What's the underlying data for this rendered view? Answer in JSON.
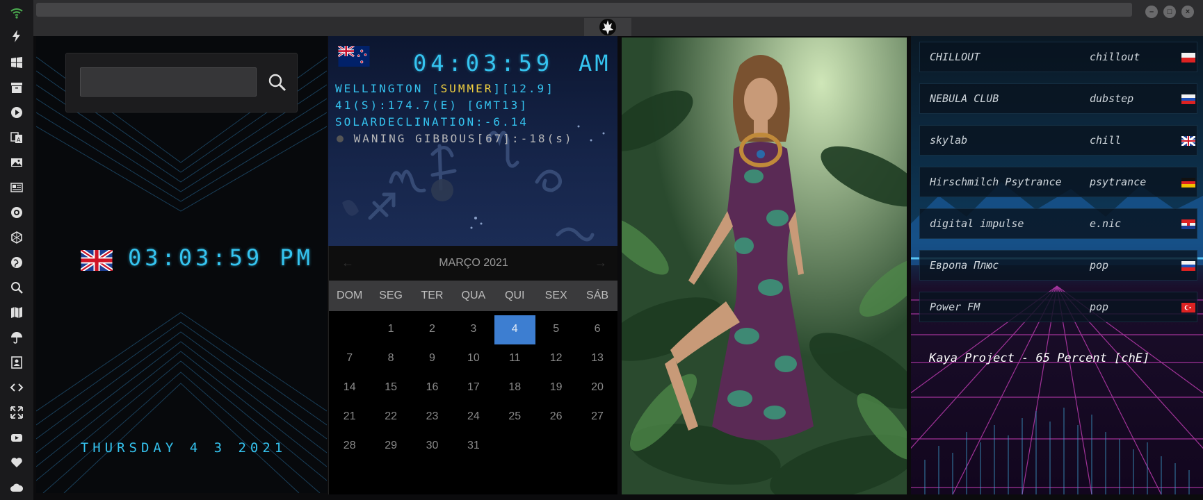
{
  "icons": {
    "rail": [
      "wifi-icon",
      "lightning-icon",
      "windows-icon",
      "archive-icon",
      "play-icon",
      "translate-icon",
      "image-icon",
      "news-icon",
      "rebel-icon",
      "hexagon-icon",
      "globe-icon",
      "search-icon",
      "map-icon",
      "umbrella-icon",
      "contact-icon",
      "code-icon",
      "fullscreen-icon",
      "youtube-icon",
      "heart-icon",
      "cloud-icon"
    ],
    "accent": "#35c4f0",
    "wifi_color": "#4caf50"
  },
  "window": {
    "logo": "rebel-alliance-icon",
    "buttons": [
      "minimize",
      "maximize",
      "close"
    ]
  },
  "clock": {
    "search_placeholder": "",
    "local_time": "03:03:59 PM",
    "local_date": "THURSDAY 4 3 2021",
    "flag": "uk-flag"
  },
  "world": {
    "time": "04:03:59",
    "ampm": "AM",
    "flag": "nz-flag",
    "line1_a": "WELLINGTON [",
    "line1_b": "SUMMER",
    "line1_c": "][12.9]",
    "line2": "41(S):174.7(E) [GMT13]",
    "line3": "SOLARDECLINATION:-6.14",
    "line4": "WANING GIBBOUS[67]:-18(s)"
  },
  "calendar": {
    "month": "MARÇO 2021",
    "prev": "←",
    "next": "→",
    "days": [
      "DOM",
      "SEG",
      "TER",
      "QUA",
      "QUI",
      "SEX",
      "SÁB"
    ],
    "weeks": [
      [
        "",
        "1",
        "2",
        "3",
        "4",
        "5",
        "6"
      ],
      [
        "7",
        "8",
        "9",
        "10",
        "11",
        "12",
        "13"
      ],
      [
        "14",
        "15",
        "16",
        "17",
        "18",
        "19",
        "20"
      ],
      [
        "21",
        "22",
        "23",
        "24",
        "25",
        "26",
        "27"
      ],
      [
        "28",
        "29",
        "30",
        "31",
        "",
        "",
        ""
      ]
    ],
    "today": "4"
  },
  "radio": {
    "stations": [
      {
        "name": "CHILLOUT",
        "genre": "chillout",
        "flag": "poland-flag"
      },
      {
        "name": "NEBULA CLUB",
        "genre": "dubstep",
        "flag": "russia-flag"
      },
      {
        "name": "skylab",
        "genre": "chill",
        "flag": "uk-flag"
      },
      {
        "name": "Hirschmilch Psytrance",
        "genre": "psytrance",
        "flag": "germany-flag"
      },
      {
        "name": "digital impulse",
        "genre": "e.nic",
        "flag": "croatia-flag"
      },
      {
        "name": "Европа Плюс",
        "genre": "pop",
        "flag": "russia-flag"
      },
      {
        "name": "Power FM",
        "genre": "pop",
        "flag": "turkey-flag"
      }
    ],
    "now_playing": "Kaya Project - 65 Percent [chE]"
  }
}
